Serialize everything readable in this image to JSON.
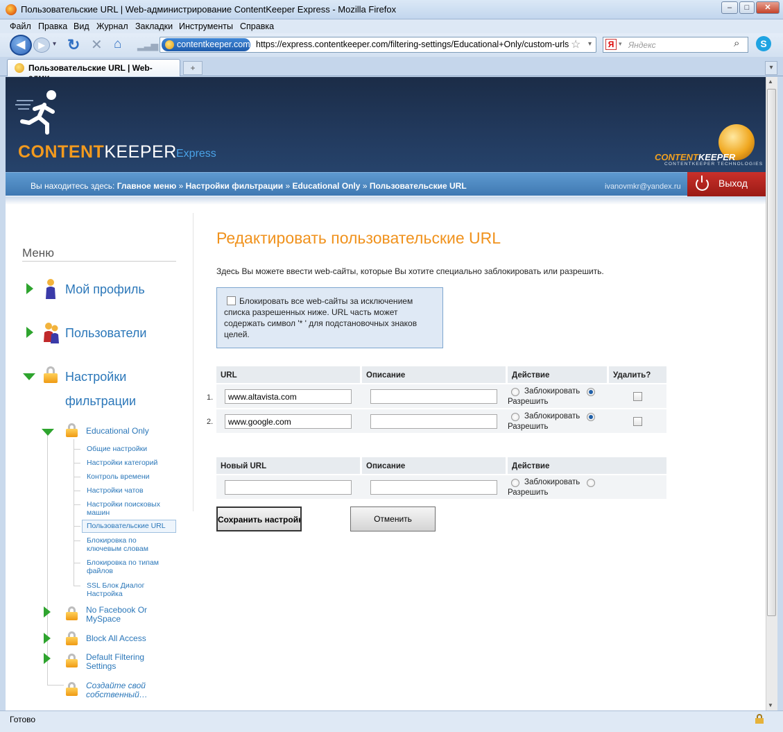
{
  "window": {
    "title": "Пользовательские URL | Web-администрирование ContentKeeper Express - Mozilla Firefox",
    "minimize": "–",
    "maximize": "□",
    "close": "✕"
  },
  "menubar": [
    "Файл",
    "Правка",
    "Вид",
    "Журнал",
    "Закладки",
    "Инструменты",
    "Справка"
  ],
  "navbar": {
    "site_badge": "contentkeeper.com",
    "url": "https://express.contentkeeper.com/filtering-settings/Educational+Only/custom-urls",
    "search_placeholder": "Яндекс",
    "search_engine_letter": "Я"
  },
  "tabs": [
    {
      "label": "Пользовательские URL | Web-адми..."
    }
  ],
  "status": {
    "text": "Готово"
  },
  "header": {
    "logo_content": "CONTENT",
    "logo_keeper": "KEEPER",
    "logo_express": "Express",
    "ck_content": "CONTENT",
    "ck_keeper": "KEEPER",
    "ck_tech": "CONTENTKEEPER TECHNOLOGIES",
    "breadcrumb_prefix": "Вы находитесь здесь:",
    "breadcrumb": [
      "Главное меню",
      "Настройки фильтрации",
      "Educational Only",
      "Пользовательские URL"
    ],
    "breadcrumb_sep": "»",
    "user_email": "ivanovmkr@yandex.ru",
    "logout": "Выход"
  },
  "sidebar": {
    "title": "Меню",
    "items": [
      {
        "label": "Мой профиль"
      },
      {
        "label": "Пользователи"
      },
      {
        "label_line1": "Настройки",
        "label_line2": "фильтрации"
      }
    ],
    "sub": {
      "profile": "Educational Only",
      "leaves": [
        "Общие настройки",
        "Настройки категорий",
        "Контроль времени",
        "Настройки чатов",
        "Настройки поисковых машин",
        "Пользовательские URL",
        "Блокировка по ключевым словам",
        "Блокировка по типам файлов",
        "SSL Блок Диалог Настройка"
      ],
      "others": [
        "No Facebook Or MySpace",
        "Block All Access",
        "Default Filtering Settings",
        "Создайте свой собственный…"
      ]
    }
  },
  "content": {
    "title": "Редактировать пользовательские URL",
    "description": "Здесь Вы можете ввести web-сайты, которые Вы хотите специально заблокировать или разрешить.",
    "block_all_text": "Блокировать все web-сайты за исключением списка разрешенных ниже. URL часть может содержать символ '* ' для подстановочных знаков целей.",
    "block_all_checked": false,
    "table": {
      "headers": [
        "URL",
        "Описание",
        "Действие",
        "Удалить?"
      ],
      "rows": [
        {
          "num": "1.",
          "url": "www.altavista.com",
          "desc": "",
          "action": "Разрешить",
          "delete": false
        },
        {
          "num": "2.",
          "url": "www.google.com",
          "desc": "",
          "action": "Разрешить",
          "delete": false
        }
      ],
      "opt_block": "Заблокировать",
      "opt_allow": "Разрешить"
    },
    "new_table": {
      "headers": [
        "Новый URL",
        "Описание",
        "Действие"
      ],
      "url": "",
      "desc": ""
    },
    "save_button": "Сохранить настройки",
    "cancel_button": "Отменить"
  }
}
